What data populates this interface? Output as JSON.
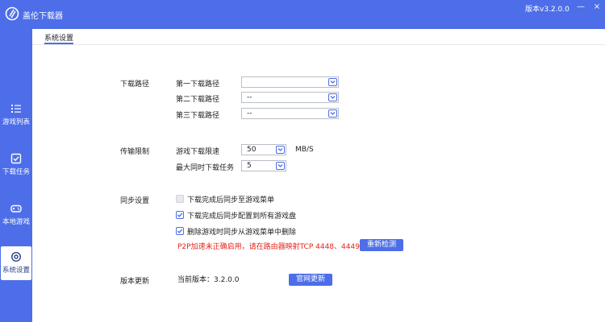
{
  "app": {
    "title": "盖伦下载器",
    "version": "版本v3.2.0.0",
    "minimize": "—",
    "close": "×"
  },
  "sidebar": {
    "items": [
      {
        "label": "游戏列表",
        "icon": "list-icon"
      },
      {
        "label": "下载任务",
        "icon": "checkbox-icon"
      },
      {
        "label": "本地游戏",
        "icon": "gamepad-icon"
      },
      {
        "label": "系统设置",
        "icon": "gear-icon",
        "active": true
      }
    ]
  },
  "tab": {
    "label": "系统设置"
  },
  "download_path": {
    "section": "下载路径",
    "first_label": "第一下载路径",
    "first_value": "",
    "second_label": "第二下载路径",
    "second_value": "--",
    "third_label": "第三下载路径",
    "third_value": "--"
  },
  "transfer_limit": {
    "section": "传输限制",
    "speed_label": "游戏下载限速",
    "speed_value": "50",
    "speed_unit": "MB/S",
    "max_tasks_label": "最大同时下载任务",
    "max_tasks_value": "5"
  },
  "sync": {
    "section": "同步设置",
    "options": [
      {
        "label": "下载完成后同步至游戏菜单",
        "checked": false,
        "disabled": true
      },
      {
        "label": "下载完成后同步配置到所有游戏盘",
        "checked": true,
        "disabled": false
      },
      {
        "label": "删除游戏时同步从游戏菜单中删除",
        "checked": true,
        "disabled": false
      }
    ],
    "warning": "P2P加速未正确启用，请在路由器映射TCP 4448、4449端口",
    "recheck_button": "重新检测"
  },
  "update": {
    "section": "版本更新",
    "current_version": "当前版本：3.2.0.0",
    "update_button": "官网更新"
  },
  "colors": {
    "accent": "#4d6ee8",
    "warning": "#e8221a"
  }
}
